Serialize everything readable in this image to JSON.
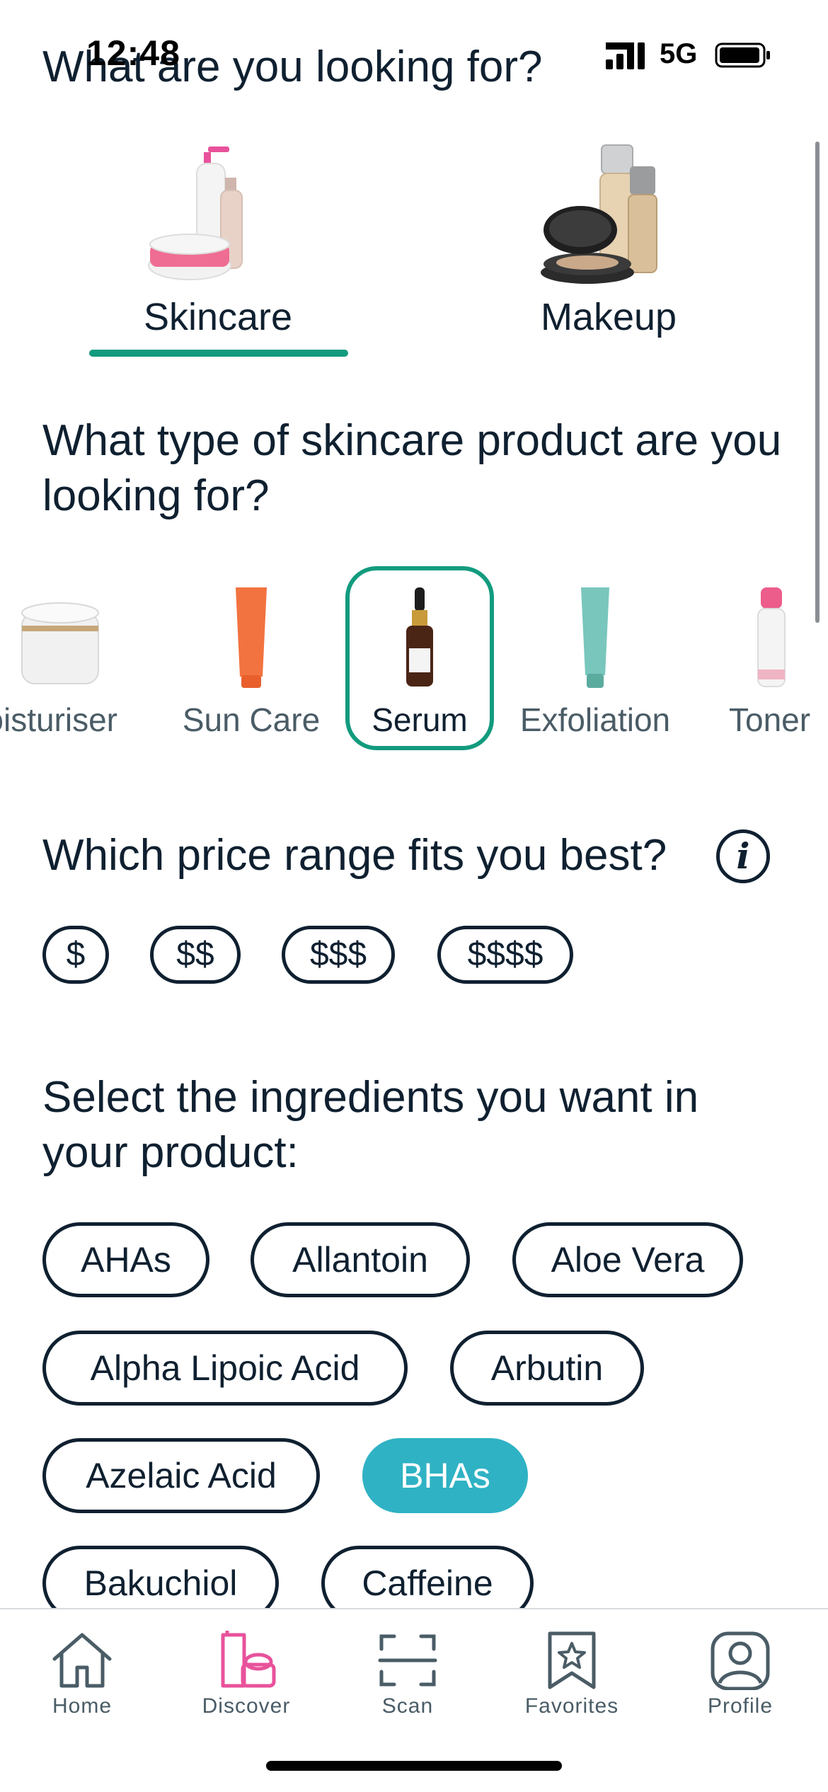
{
  "status": {
    "time": "12:48",
    "network": "5G"
  },
  "questions": {
    "q1": "What are you looking for?",
    "q2": "What type of skincare product are you looking for?",
    "q3": "Which price range fits you best?",
    "q4": "Select the ingredients you want in your product:"
  },
  "categories": [
    {
      "label": "Skincare",
      "selected": true
    },
    {
      "label": "Makeup",
      "selected": false
    }
  ],
  "product_types": [
    {
      "label": "oisturiser",
      "selected": false
    },
    {
      "label": "Sun Care",
      "selected": false
    },
    {
      "label": "Serum",
      "selected": true
    },
    {
      "label": "Exfoliation",
      "selected": false
    },
    {
      "label": "Toner",
      "selected": false
    }
  ],
  "price_ranges": [
    "$",
    "$$",
    "$$$",
    "$$$$"
  ],
  "ingredients": [
    {
      "label": "AHAs",
      "selected": false
    },
    {
      "label": "Allantoin",
      "selected": false
    },
    {
      "label": "Aloe Vera",
      "selected": false
    },
    {
      "label": "Alpha Lipoic Acid",
      "selected": false
    },
    {
      "label": "Arbutin",
      "selected": false
    },
    {
      "label": "Azelaic Acid",
      "selected": false
    },
    {
      "label": "BHAs",
      "selected": true
    },
    {
      "label": "Bakuchiol",
      "selected": false
    },
    {
      "label": "Caffeine",
      "selected": false
    }
  ],
  "tabbar": [
    {
      "label": "Home",
      "icon": "home-icon",
      "active": false
    },
    {
      "label": "Discover",
      "icon": "discover-icon",
      "active": true
    },
    {
      "label": "Scan",
      "icon": "scan-icon",
      "active": false
    },
    {
      "label": "Favorites",
      "icon": "favorites-icon",
      "active": false
    },
    {
      "label": "Profile",
      "icon": "profile-icon",
      "active": false
    }
  ],
  "colors": {
    "accent_green": "#129b7e",
    "selected_chip": "#2fb2c4",
    "active_tab": "#e8529b",
    "text": "#0f2030"
  }
}
